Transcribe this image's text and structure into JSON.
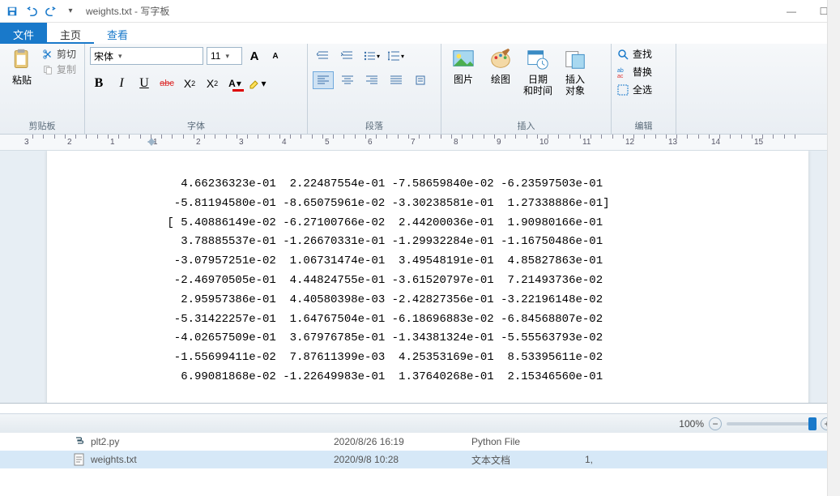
{
  "title": "weights.txt - 写字板",
  "tabs": {
    "file": "文件",
    "home": "主页",
    "view": "查看"
  },
  "groups": {
    "clipboard": {
      "paste": "粘贴",
      "cut": "剪切",
      "copy": "复制",
      "label": "剪贴板"
    },
    "font": {
      "name": "宋体",
      "size": "11",
      "label": "字体"
    },
    "paragraph": {
      "label": "段落"
    },
    "insert": {
      "picture": "图片",
      "paint": "绘图",
      "datetime_l1": "日期",
      "datetime_l2": "和时间",
      "object_l1": "插入",
      "object_l2": "对象",
      "label": "插入"
    },
    "edit": {
      "find": "查找",
      "replace": "替换",
      "selectall": "全选",
      "label": "编辑"
    }
  },
  "ruler": {
    "marks": [
      "3",
      "2",
      "1",
      "1",
      "2",
      "3",
      "4",
      "5",
      "6",
      "7",
      "8",
      "9",
      "10",
      "11",
      "12",
      "13",
      "14",
      "15"
    ]
  },
  "document_lines": [
    "   4.66236323e-01  2.22487554e-01 -7.58659840e-02 -6.23597503e-01",
    "  -5.81194580e-01 -8.65075961e-02 -3.30238581e-01  1.27338886e-01]",
    " [ 5.40886149e-02 -6.27100766e-02  2.44200036e-01  1.90980166e-01",
    "   3.78885537e-01 -1.26670331e-01 -1.29932284e-01 -1.16750486e-01",
    "  -3.07957251e-02  1.06731474e-01  3.49548191e-01  4.85827863e-01",
    "  -2.46970505e-01  4.44824755e-01 -3.61520797e-01  7.21493736e-02",
    "   2.95957386e-01  4.40580398e-03 -2.42827356e-01 -3.22196148e-02",
    "  -5.31422257e-01  1.64767504e-01 -6.18696883e-02 -6.84568807e-02",
    "  -4.02657509e-01  3.67976785e-01 -1.34381324e-01 -5.55563793e-02",
    "  -1.55699411e-02  7.87611399e-03  4.25353169e-01  8.53395611e-02",
    "   6.99081868e-02 -1.22649983e-01  1.37640268e-01  2.15346560e-01"
  ],
  "status": {
    "zoom": "100%"
  },
  "explorer": {
    "rows": [
      {
        "name": "plt2.py",
        "date": "2020/8/26 16:19",
        "type": "Python File",
        "size": ""
      },
      {
        "name": "weights.txt",
        "date": "2020/9/8 10:28",
        "type": "文本文档",
        "size": "1,"
      }
    ]
  }
}
